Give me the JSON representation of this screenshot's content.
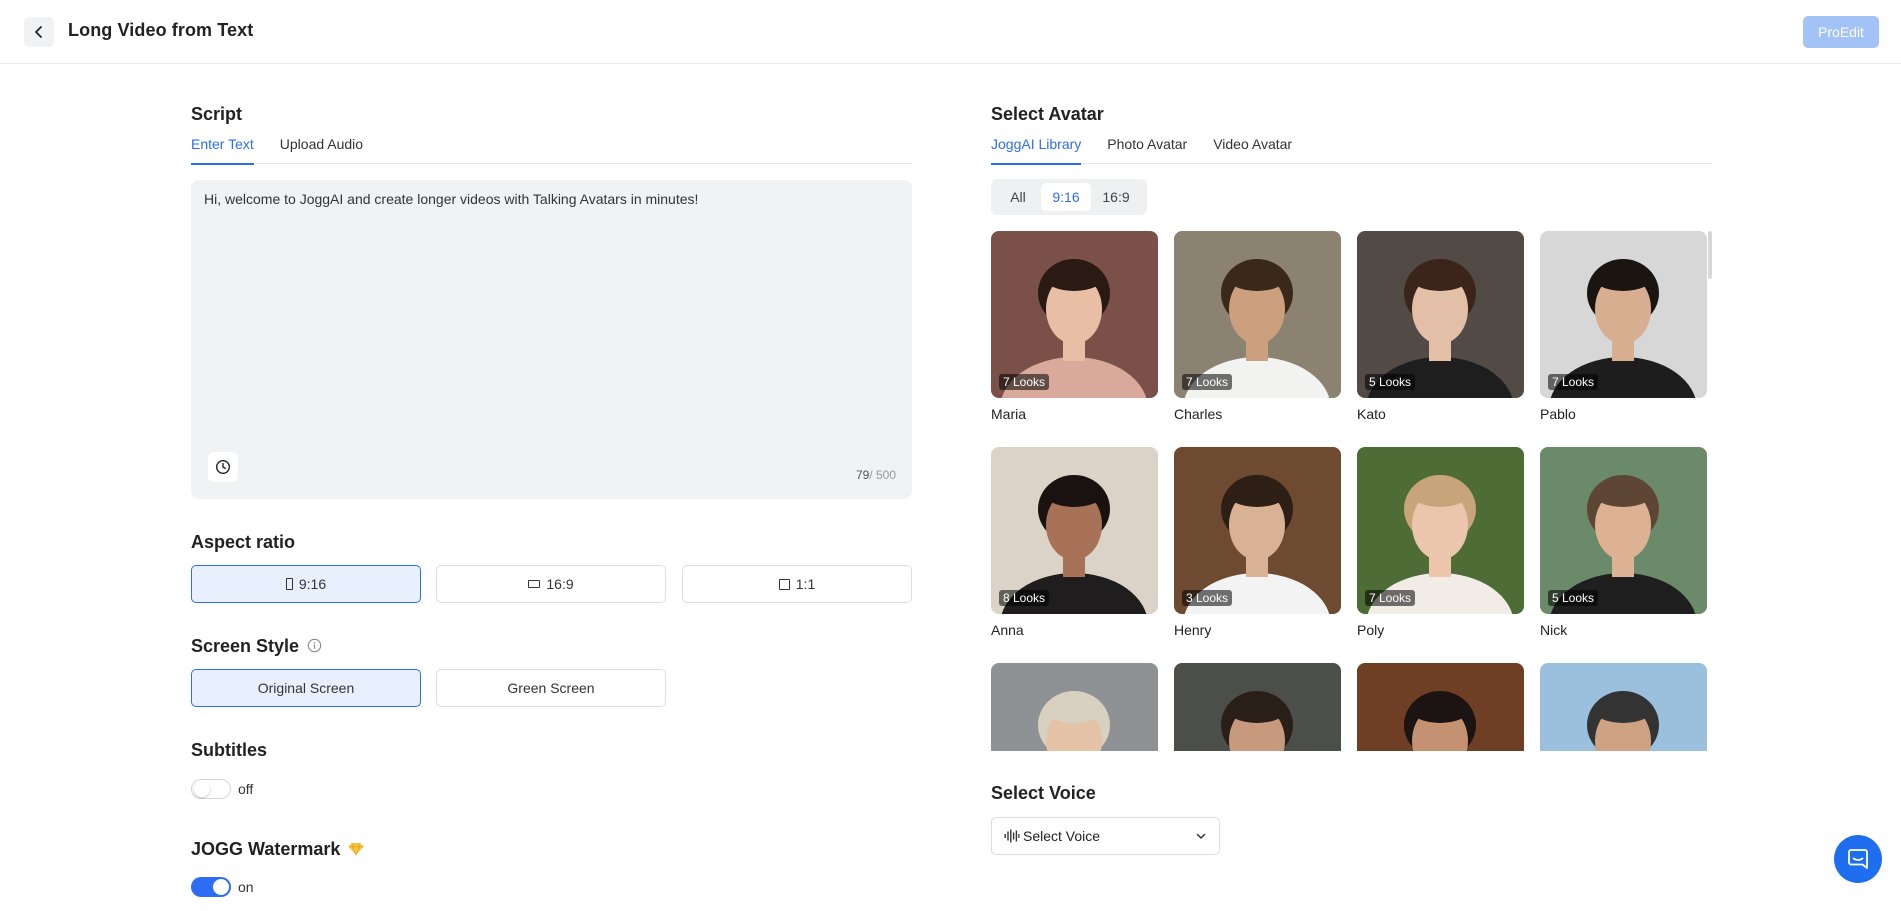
{
  "header": {
    "title": "Long Video from Text",
    "proedit_label": "ProEdit"
  },
  "script": {
    "title": "Script",
    "tabs": [
      {
        "label": "Enter Text",
        "active": true
      },
      {
        "label": "Upload Audio",
        "active": false
      }
    ],
    "text": "Hi, welcome to JoggAI and create longer videos with Talking Avatars in minutes!",
    "char_count": "79",
    "char_limit": "/ 500"
  },
  "aspect_ratio": {
    "title": "Aspect ratio",
    "options": [
      {
        "label": "9:16",
        "selected": true
      },
      {
        "label": "16:9",
        "selected": false
      },
      {
        "label": "1:1",
        "selected": false
      }
    ]
  },
  "screen_style": {
    "title": "Screen Style",
    "info_icon": "info-icon",
    "options": [
      {
        "label": "Original Screen",
        "selected": true
      },
      {
        "label": "Green Screen",
        "selected": false
      }
    ]
  },
  "subtitles": {
    "title": "Subtitles",
    "state_label": "off",
    "on": false
  },
  "watermark": {
    "title": "JOGG Watermark",
    "premium_icon": "diamond-icon",
    "state_label": "on",
    "on": true
  },
  "avatar": {
    "title": "Select Avatar",
    "tabs": [
      {
        "label": "JoggAI Library",
        "active": true
      },
      {
        "label": "Photo Avatar",
        "active": false
      },
      {
        "label": "Video Avatar",
        "active": false
      }
    ],
    "ratio_filter": [
      {
        "label": "All",
        "active": false
      },
      {
        "label": "9:16",
        "active": true
      },
      {
        "label": "16:9",
        "active": false
      }
    ],
    "items": [
      {
        "name": "Maria",
        "looks": "7 Looks",
        "bg": "#7a5048",
        "skin": "#e8bea4",
        "hair": "#2b1a14",
        "shirt": "#d9a99b"
      },
      {
        "name": "Charles",
        "looks": "7 Looks",
        "bg": "#8c8271",
        "skin": "#caa07f",
        "hair": "#3a2818",
        "shirt": "#f2f2f0"
      },
      {
        "name": "Kato",
        "looks": "5 Looks",
        "bg": "#524a45",
        "skin": "#e4bfa8",
        "hair": "#3b2419",
        "shirt": "#1e1e1e"
      },
      {
        "name": "Pablo",
        "looks": "7 Looks",
        "bg": "#d7d7d8",
        "skin": "#d8ae90",
        "hair": "#1b1512",
        "shirt": "#1d1d1d"
      },
      {
        "name": "Anna",
        "looks": "8 Looks",
        "bg": "#dcd3c8",
        "skin": "#a87258",
        "hair": "#1a1210",
        "shirt": "#1f1d1d"
      },
      {
        "name": "Henry",
        "looks": "3 Looks",
        "bg": "#6e4a31",
        "skin": "#d9b296",
        "hair": "#2d1e16",
        "shirt": "#f3f3f3"
      },
      {
        "name": "Poly",
        "looks": "7 Looks",
        "bg": "#4e6c36",
        "skin": "#ebc6ad",
        "hair": "#c8a47a",
        "shirt": "#f1ece6"
      },
      {
        "name": "Nick",
        "looks": "5 Looks",
        "bg": "#6b8a6a",
        "skin": "#dcb194",
        "hair": "#5e4634",
        "shirt": "#1f1f1f"
      },
      {
        "name": "",
        "looks": "",
        "bg": "#8f9294",
        "skin": "#e4c2a6",
        "hair": "#d8d0c0",
        "shirt": "#555555"
      },
      {
        "name": "",
        "looks": "",
        "bg": "#4c4e4a",
        "skin": "#c79a7e",
        "hair": "#2a1e18",
        "shirt": "#333333"
      },
      {
        "name": "",
        "looks": "",
        "bg": "#6e3f25",
        "skin": "#c49273",
        "hair": "#1c1412",
        "shirt": "#333333"
      },
      {
        "name": "",
        "looks": "",
        "bg": "#9ac0de",
        "skin": "#cfa283",
        "hair": "#333333",
        "shirt": "#555555"
      }
    ]
  },
  "voice": {
    "title": "Select Voice",
    "select_label": "Select Voice",
    "icon": "waveform-icon"
  },
  "colors": {
    "accent": "#2d6df6",
    "proedit": "#a3c3f6",
    "chat": "#1f6ef0"
  }
}
